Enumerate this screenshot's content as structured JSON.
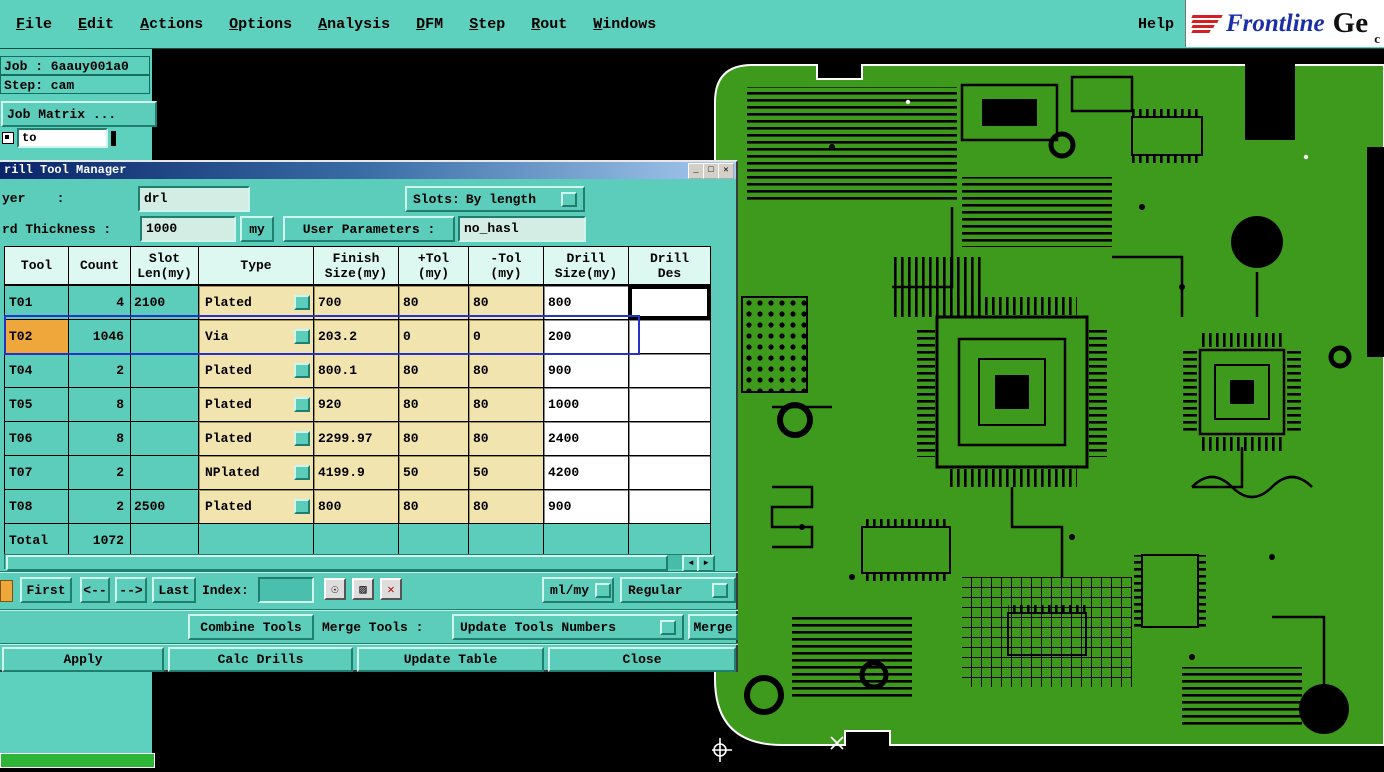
{
  "menu": {
    "items": [
      "File",
      "Edit",
      "Actions",
      "Options",
      "Analysis",
      "DFM",
      "Step",
      "Rout",
      "Windows"
    ],
    "help": "Help"
  },
  "brand": {
    "name": "Frontline",
    "suffix": "Ge",
    "sub": "c"
  },
  "job_panel": {
    "job_label": "Job : 6aauy001a0",
    "step_label": "Step: cam",
    "job_matrix_button": "Job Matrix ...",
    "to_value": "to"
  },
  "dialog": {
    "title": "rill Tool Manager",
    "layer_label": "yer    :",
    "layer_value": "drl",
    "slots_label": "Slots:",
    "slots_value": "By length",
    "thickness_label": "rd Thickness :",
    "thickness_value": "1000",
    "thickness_unit": "my",
    "user_params_label": "User Parameters :",
    "user_params_value": "no_hasl",
    "table": {
      "headers": [
        {
          "l1": "Tool",
          "l2": ""
        },
        {
          "l1": "Count",
          "l2": ""
        },
        {
          "l1": "Slot",
          "l2": "Len(my)"
        },
        {
          "l1": "Type",
          "l2": ""
        },
        {
          "l1": "Finish",
          "l2": "Size(my)"
        },
        {
          "l1": "+Tol",
          "l2": "(my)"
        },
        {
          "l1": "-Tol",
          "l2": "(my)"
        },
        {
          "l1": "Drill",
          "l2": "Size(my)"
        },
        {
          "l1": "Drill",
          "l2": "Des"
        }
      ],
      "rows": [
        {
          "tool": "T01",
          "count": "4",
          "slot": "2100",
          "type": "Plated",
          "finish": "700",
          "ptol": "80",
          "ntol": "80",
          "drill": "800",
          "des": ""
        },
        {
          "tool": "T02",
          "count": "1046",
          "slot": "",
          "type": "Via",
          "finish": "203.2",
          "ptol": "0",
          "ntol": "0",
          "drill": "200",
          "des": ""
        },
        {
          "tool": "T04",
          "count": "2",
          "slot": "",
          "type": "Plated",
          "finish": "800.1",
          "ptol": "80",
          "ntol": "80",
          "drill": "900",
          "des": ""
        },
        {
          "tool": "T05",
          "count": "8",
          "slot": "",
          "type": "Plated",
          "finish": "920",
          "ptol": "80",
          "ntol": "80",
          "drill": "1000",
          "des": ""
        },
        {
          "tool": "T06",
          "count": "8",
          "slot": "",
          "type": "Plated",
          "finish": "2299.97",
          "ptol": "80",
          "ntol": "80",
          "drill": "2400",
          "des": ""
        },
        {
          "tool": "T07",
          "count": "2",
          "slot": "",
          "type": "NPlated",
          "finish": "4199.9",
          "ptol": "50",
          "ntol": "50",
          "drill": "4200",
          "des": ""
        },
        {
          "tool": "T08",
          "count": "2",
          "slot": "2500",
          "type": "Plated",
          "finish": "800",
          "ptol": "80",
          "ntol": "80",
          "drill": "900",
          "des": ""
        }
      ],
      "selected_row": 1,
      "focused_des_row": 0,
      "total_label": "Total",
      "total_count": "1072"
    },
    "nav": {
      "first": "First",
      "prev": "<--",
      "next": "-->",
      "last": "Last",
      "index_label": "Index:",
      "index_value": "",
      "units_value": "ml/my",
      "mode_value": "Regular"
    },
    "actions": {
      "combine": "Combine Tools",
      "merge_tools_label": "Merge Tools :",
      "update_tools": "Update Tools Numbers",
      "merge": "Merge",
      "apply": "Apply",
      "calc_drills": "Calc Drills",
      "update_table": "Update Table",
      "close": "Close"
    }
  },
  "icons": {
    "minimize": "_",
    "maximize": "□",
    "close": "✕",
    "bulb": "☉",
    "pattern": "▨",
    "delete": "✕",
    "scroll_left": "◄",
    "scroll_right": "►"
  }
}
